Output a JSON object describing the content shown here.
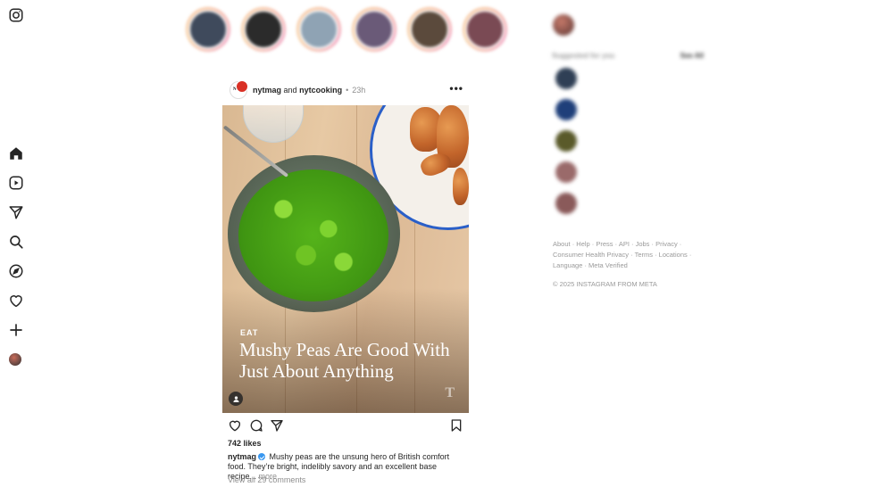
{
  "nav": {
    "items": [
      {
        "name": "instagram-logo-icon"
      },
      {
        "name": "home-icon"
      },
      {
        "name": "reels-icon"
      },
      {
        "name": "messages-icon"
      },
      {
        "name": "search-icon"
      },
      {
        "name": "explore-icon"
      },
      {
        "name": "notifications-icon"
      },
      {
        "name": "create-icon"
      },
      {
        "name": "profile-avatar"
      }
    ]
  },
  "stories": [
    {
      "name": "",
      "color": "#3f4a5c"
    },
    {
      "name": "",
      "color": "#2b2b2b"
    },
    {
      "name": "",
      "color": "#8fa3b4"
    },
    {
      "name": "",
      "color": "#6a5a78"
    },
    {
      "name": "",
      "color": "#5b4a3c"
    },
    {
      "name": "",
      "color": "#7a4a54"
    }
  ],
  "post": {
    "account_primary": "nytmag",
    "joiner": "and",
    "account_secondary": "nytcooking",
    "separator": "•",
    "time": "23h",
    "more": "•••",
    "image": {
      "kicker": "EAT",
      "headline": "Mushy Peas Are Good With Just About Anything",
      "watermark": "T"
    },
    "likes": "742 likes",
    "caption_user": "nytmag",
    "caption_text": "Mushy peas are the unsung hero of British comfort food. They’re bright, indelibly savory and an excellent base recipe...",
    "caption_more": "more",
    "view_comments": "View all 29 comments"
  },
  "sidebar": {
    "me": {
      "username": "",
      "subtitle": "",
      "action": ""
    },
    "suggested_title": "Suggested for you",
    "see_all": "See All",
    "suggestions": [
      {
        "name": "",
        "sub": "",
        "action": "",
        "color": "#2f3f55"
      },
      {
        "name": "",
        "sub": "",
        "action": "",
        "color": "#1f3f7a"
      },
      {
        "name": "",
        "sub": "",
        "action": "",
        "color": "#5a5a2a"
      },
      {
        "name": "",
        "sub": "",
        "action": "",
        "color": "#9a6a6a"
      },
      {
        "name": "",
        "sub": "",
        "action": "",
        "color": "#8a5a5a"
      }
    ]
  },
  "footer": {
    "links": [
      "About",
      "Help",
      "Press",
      "API",
      "Jobs",
      "Privacy",
      "Consumer Health Privacy",
      "Terms",
      "Locations",
      "Language",
      "Meta Verified"
    ],
    "copyright": "© 2025 INSTAGRAM FROM META"
  }
}
